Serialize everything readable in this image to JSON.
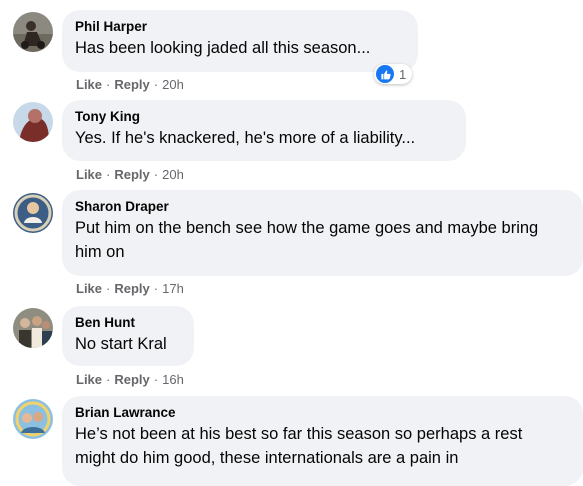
{
  "comments": [
    {
      "author": "Phil Harper",
      "text": "Has been looking jaded all this season...",
      "like_label": "Like",
      "reply_label": "Reply",
      "time": "20h",
      "reaction_count": "1",
      "avatar_color": "#5a4a42"
    },
    {
      "author": "Tony King",
      "text": "Yes. If he's knackered, he's more of a liability...",
      "like_label": "Like",
      "reply_label": "Reply",
      "time": "20h",
      "avatar_color": "#7a3a35"
    },
    {
      "author": "Sharon Draper",
      "text": "Put him on the bench see how the game goes and maybe bring him on",
      "like_label": "Like",
      "reply_label": "Reply",
      "time": "17h",
      "avatar_color": "#4d6a8f"
    },
    {
      "author": "Ben Hunt",
      "text": "No start Kral",
      "like_label": "Like",
      "reply_label": "Reply",
      "time": "16h",
      "avatar_color": "#6b6f5a"
    },
    {
      "author": "Brian Lawrance",
      "text": "He’s not been at his best so far this season so perhaps a rest might do him good, these internationals are a pain in",
      "avatar_color": "#6aa0c8"
    }
  ],
  "colors": {
    "bubble": "#f0f2f5",
    "meta": "#65676b",
    "like_blue": "#1877f2"
  }
}
